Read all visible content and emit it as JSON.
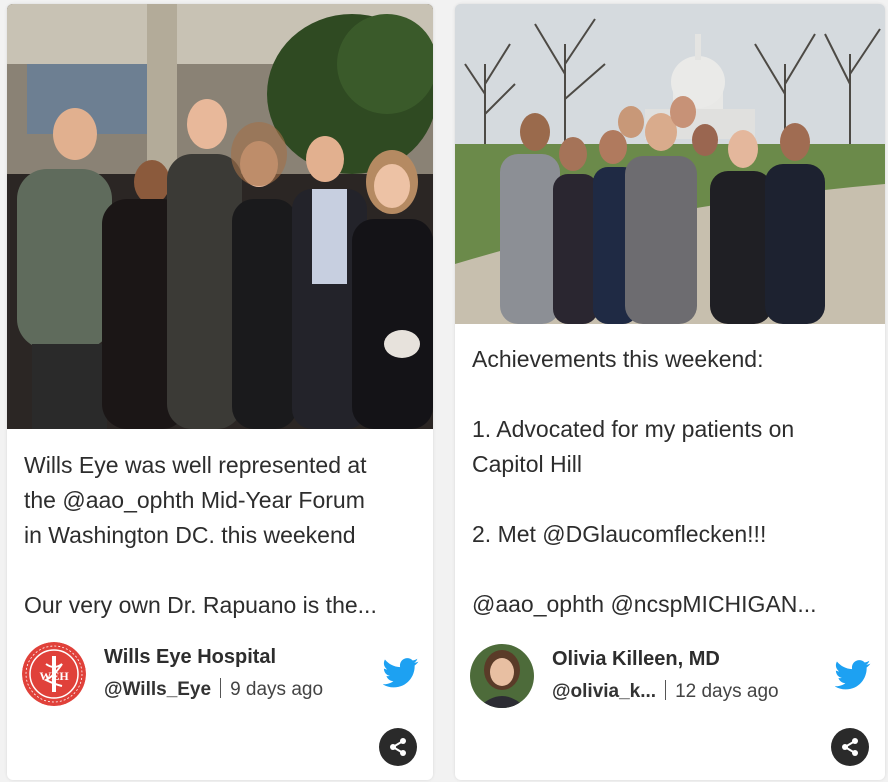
{
  "brand_colors": {
    "twitter": "#1DA1F2",
    "share": "#2a2a2a",
    "wills_logo": "#e0413a"
  },
  "posts": [
    {
      "photo_alt": "group-photo-indoor",
      "text": "Wills Eye was well represented at\nthe @aao_ophth Mid-Year Forum\nin Washington DC. this weekend\n\nOur very own Dr. Rapuano is the...",
      "author": {
        "name": "Wills Eye Hospital",
        "handle": "@Wills_Eye",
        "time": "9 days ago",
        "avatar_letters": "WEH"
      },
      "icons": {
        "network": "twitter-icon",
        "action": "share-icon"
      }
    },
    {
      "photo_alt": "group-photo-capitol",
      "text": "Achievements this weekend:\n\n1. Advocated for my patients on\nCapitol Hill\n\n2. Met @DGlaucomflecken!!!\n\n@aao_ophth @ncspMICHIGAN...",
      "author": {
        "name": "Olivia Killeen, MD",
        "handle": "@olivia_k...",
        "time": "12 days ago"
      },
      "icons": {
        "network": "twitter-icon",
        "action": "share-icon"
      }
    }
  ]
}
